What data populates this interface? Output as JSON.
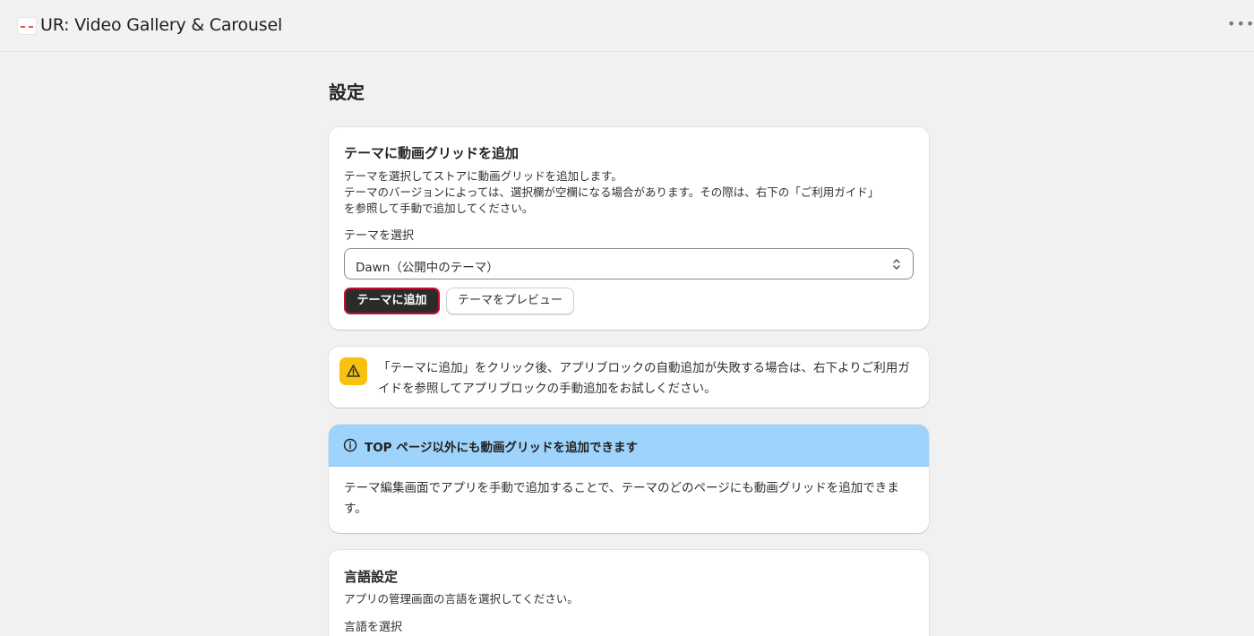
{
  "app": {
    "title": "UR: Video Gallery & Carousel",
    "logo_icon": "app-logo-icon",
    "more_icon": "more-horizontal-icon"
  },
  "page": {
    "title": "設定"
  },
  "theme_card": {
    "heading": "テーマに動画グリッドを追加",
    "description_lines": [
      "テーマを選択してストアに動画グリッドを追加します。",
      "テーマのバージョンによっては、選択欄が空欄になる場合があります。その際は、右下の「ご利用ガイド」",
      "を参照して手動で追加してください。"
    ],
    "select_label": "テーマを選択",
    "select_value": "Dawn（公開中のテーマ）",
    "add_button": "テーマに追加",
    "preview_button": "テーマをプレビュー"
  },
  "warning": {
    "icon": "warning-triangle-icon",
    "color": "#f7c10f",
    "text": "「テーマに追加」をクリック後、アプリブロックの自動追加が失敗する場合は、右下よりご利用ガイドを参照してアプリブロックの手動追加をお試しください。"
  },
  "info_banner": {
    "icon": "info-circle-icon",
    "color": "#9ed3fb",
    "title": "TOP ページ以外にも動画グリッドを追加できます",
    "body": "テーマ編集画面でアプリを手動で追加することで、テーマのどのページにも動画グリッドを追加できます。"
  },
  "language_card": {
    "heading": "言語設定",
    "description": "アプリの管理画面の言語を選択してください。",
    "select_label": "言語を選択"
  }
}
